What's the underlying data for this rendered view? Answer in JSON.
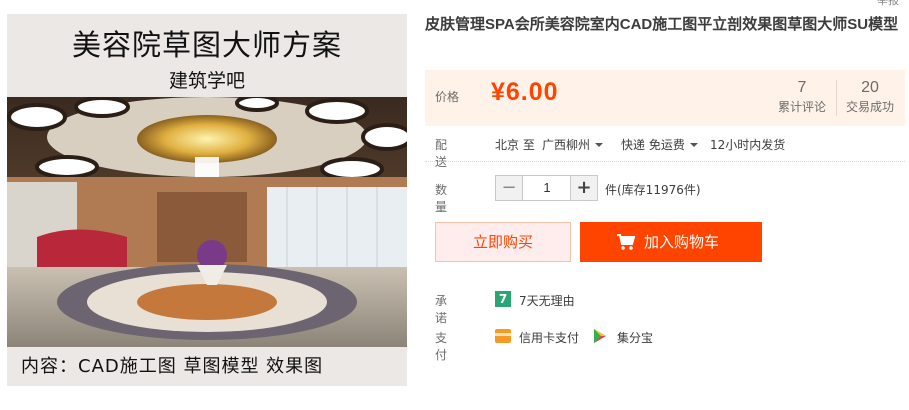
{
  "image": {
    "title": "美容院草图大师方案",
    "subtitle": "建筑学吧",
    "footer": "内容：CAD施工图  草图模型  效果图"
  },
  "corner_text": "举报",
  "product": {
    "title": "皮肤管理SPA会所美容院室内CAD施工图平立剖效果图草图大师SU模型"
  },
  "price_panel": {
    "label": "价格",
    "price": "¥6.00",
    "reviews_count": "7",
    "reviews_label": "累计评论",
    "sales_count": "20",
    "sales_label": "交易成功"
  },
  "shipping": {
    "label": "配送",
    "from": "北京 至",
    "to": "广西柳州",
    "method": "快递 免运费",
    "dispatch": "12小时内发货"
  },
  "quantity": {
    "label": "数量",
    "minus": "−",
    "value": "1",
    "plus": "+",
    "stock_text": "件(库存11976件)"
  },
  "buttons": {
    "buy_now": "立即购买",
    "add_to_cart": "加入购物车"
  },
  "promise": {
    "label": "承诺",
    "icon_text": "7",
    "text": "7天无理由"
  },
  "payment": {
    "label": "支付",
    "method1": "信用卡支付",
    "method2": "集分宝"
  },
  "colors": {
    "accent": "#ff4400",
    "price_bg": "#fff2e8",
    "buy_now_bg": "#ffeded",
    "promise_icon": "#2aa574"
  }
}
